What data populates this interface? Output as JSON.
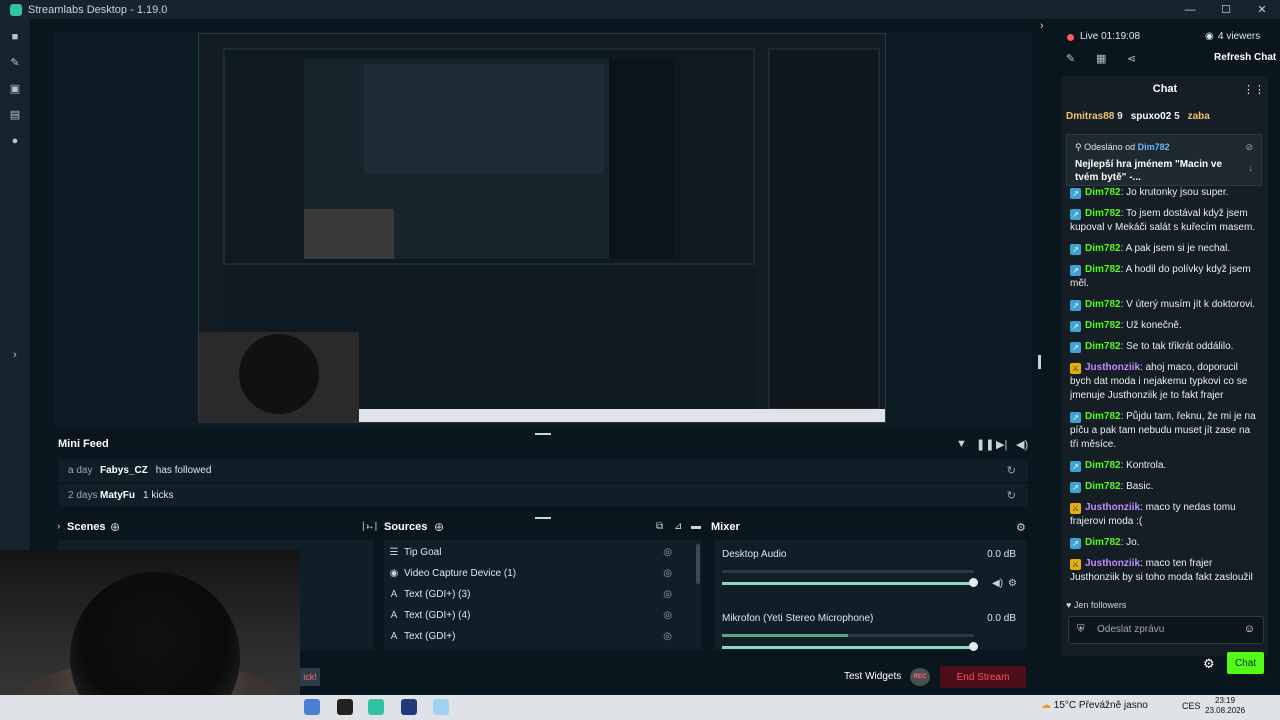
{
  "window": {
    "title": "Streamlabs Desktop - 1.19.0",
    "controls": [
      "—",
      "☐",
      "✕"
    ]
  },
  "nav_icons": [
    "studio-icon",
    "themes-icon",
    "store-icon",
    "layout-icon",
    "record-icon"
  ],
  "minifeed": {
    "title": "Mini Feed",
    "rows": [
      {
        "time": "a day",
        "user": "Fabys_CZ",
        "action": "has followed"
      },
      {
        "time": "2 days",
        "user": "MatyFu",
        "action": "1 kicks"
      }
    ]
  },
  "docks": {
    "scenes_title": "Scenes",
    "sources_title": "Sources",
    "mixer_title": "Mixer",
    "sources": [
      {
        "icon": "list-icon",
        "name": "Tip Goal"
      },
      {
        "icon": "camera-icon",
        "name": "Video Capture Device (1)"
      },
      {
        "icon": "text-icon",
        "name": "Text (GDI+) (3)"
      },
      {
        "icon": "text-icon",
        "name": "Text (GDI+) (4)"
      },
      {
        "icon": "text-icon",
        "name": "Text (GDI+)"
      }
    ],
    "mixer": [
      {
        "name": "Desktop Audio",
        "db": "0.0 dB",
        "level": 0.0,
        "volume": 1.0
      },
      {
        "name": "Mikrofon (Yeti Stereo Microphone)",
        "db": "0.0 dB",
        "level": 0.5,
        "volume": 1.0
      }
    ]
  },
  "footer": {
    "kick_badge": "ick!",
    "test_widgets": "Test Widgets",
    "rec_label": "REC",
    "end_stream": "End Stream"
  },
  "chat": {
    "live": "Live 01:19:08",
    "viewers": "4 viewers",
    "refresh": "Refresh Chat",
    "title": "Chat",
    "gifters": [
      {
        "name": "Dmitras88",
        "count": "9"
      },
      {
        "name": "spuxo02",
        "count": "5"
      },
      {
        "name": "zaba",
        "count": ""
      }
    ],
    "pinned": {
      "label": "Odesláno od",
      "user": "Dim782",
      "message": "Nejlepší hra jménem \"Macin ve tvém bytě\" -..."
    },
    "messages": [
      {
        "user": "Dim782",
        "color": "#53fc18",
        "badge": "bot",
        "text": "Jo krutonky jsou super."
      },
      {
        "user": "Dim782",
        "color": "#53fc18",
        "badge": "bot",
        "text": "To jsem dostával když jsem kupoval v Mekáči salát s kuřecím masem."
      },
      {
        "user": "Dim782",
        "color": "#53fc18",
        "badge": "bot",
        "text": "A pak jsem si je nechal."
      },
      {
        "user": "Dim782",
        "color": "#53fc18",
        "badge": "bot",
        "text": "A hodil do polívky když jsem měl."
      },
      {
        "user": "Dim782",
        "color": "#53fc18",
        "badge": "bot",
        "text": "V úterý musím jít k doktorovi."
      },
      {
        "user": "Dim782",
        "color": "#53fc18",
        "badge": "bot",
        "text": "Už konečně."
      },
      {
        "user": "Dim782",
        "color": "#53fc18",
        "badge": "bot",
        "text": "Se to tak třikrát oddálilo."
      },
      {
        "user": "Justhonziik",
        "color": "#c08cff",
        "badge": "mod",
        "text": "ahoj maco, doporucil bych dat moda i nejakemu typkovi co se jmenuje Justhonziik je to fakt frajer"
      },
      {
        "user": "Dim782",
        "color": "#53fc18",
        "badge": "bot",
        "text": "Půjdu tam, řeknu, že mi je na píču a pak tam nebudu muset jít zase na tři měsíce."
      },
      {
        "user": "Dim782",
        "color": "#53fc18",
        "badge": "bot",
        "text": "Kontrola."
      },
      {
        "user": "Dim782",
        "color": "#53fc18",
        "badge": "bot",
        "text": "Basic."
      },
      {
        "user": "Justhonziik",
        "color": "#c08cff",
        "badge": "mod",
        "text": "maco ty nedas tomu frajerovi moda :("
      },
      {
        "user": "Dim782",
        "color": "#53fc18",
        "badge": "bot",
        "text": "Jo."
      },
      {
        "user": "Justhonziik",
        "color": "#c08cff",
        "badge": "mod",
        "text": "maco ten frajer Justhonziik by si toho moda fakt zasloužil"
      }
    ],
    "followers_only": "Jen followers",
    "input_placeholder": "Odeslat zprávu",
    "send": "Chat"
  },
  "taskbar": {
    "weather": "15°C  Převážně jasno",
    "lang": "CES",
    "time": "23:19",
    "date": "23.08.2026"
  }
}
